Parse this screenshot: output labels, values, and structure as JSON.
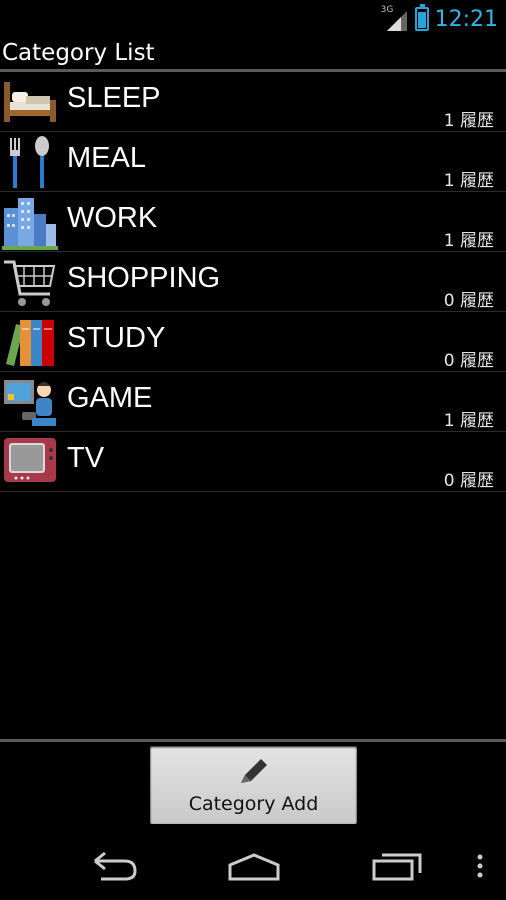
{
  "status_bar": {
    "network_label": "3G",
    "time": "12:21"
  },
  "header": {
    "title": "Category List"
  },
  "categories": [
    {
      "name": "SLEEP",
      "count": "1 履歴",
      "icon": "bed-icon"
    },
    {
      "name": "MEAL",
      "count": "1 履歴",
      "icon": "fork-spoon-icon"
    },
    {
      "name": "WORK",
      "count": "1 履歴",
      "icon": "office-building-icon"
    },
    {
      "name": "SHOPPING",
      "count": "0 履歴",
      "icon": "shopping-cart-icon"
    },
    {
      "name": "STUDY",
      "count": "0 履歴",
      "icon": "books-icon"
    },
    {
      "name": "GAME",
      "count": "1 履歴",
      "icon": "game-player-icon"
    },
    {
      "name": "TV",
      "count": "0 履歴",
      "icon": "television-icon"
    }
  ],
  "toolbar": {
    "add_label": "Category Add",
    "add_icon": "pencil-icon"
  },
  "colors": {
    "accent": "#33b5e5",
    "background": "#000000",
    "button_bg": "#d6d6d6"
  }
}
